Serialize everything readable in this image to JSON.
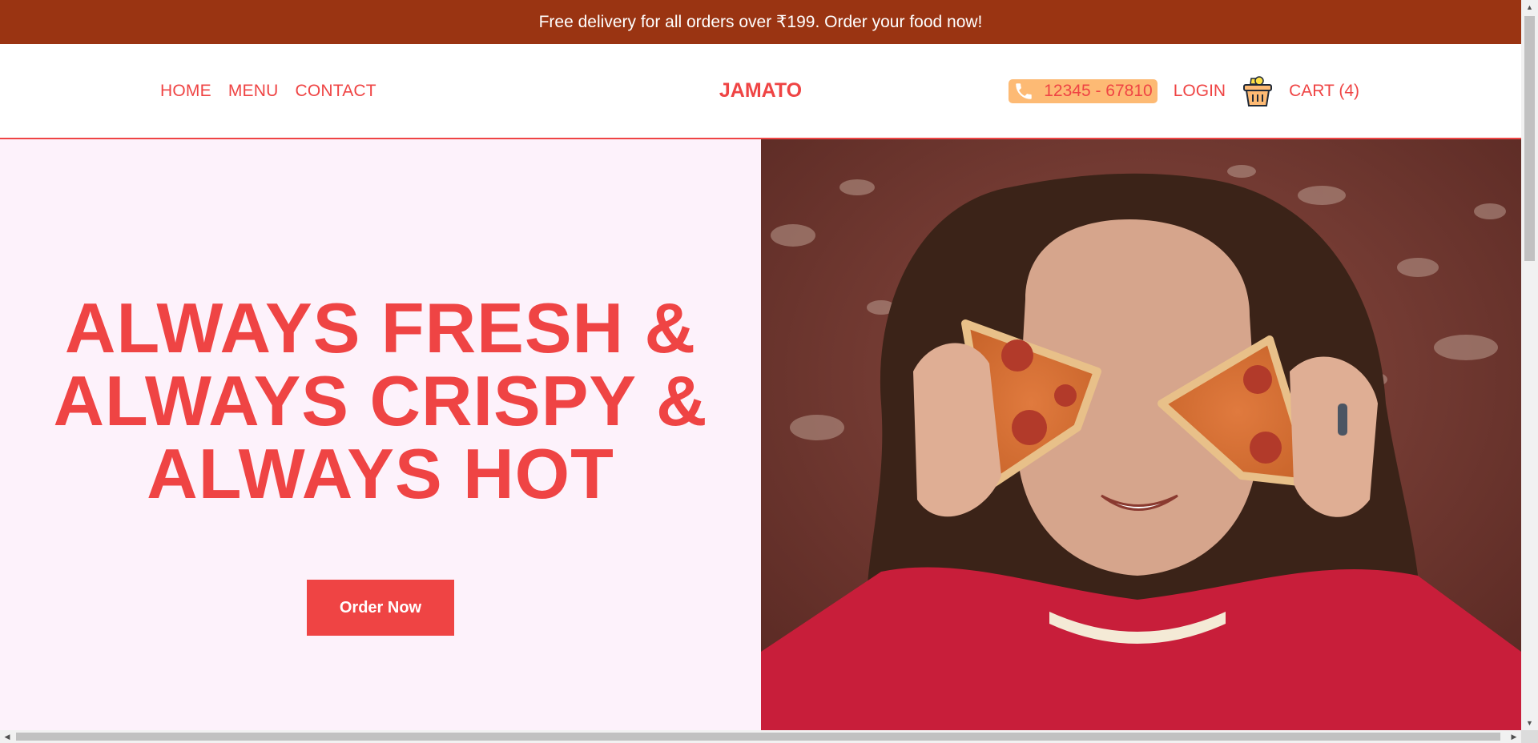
{
  "promo": {
    "text": "Free delivery for all orders over ₹199. Order your food now!"
  },
  "nav": {
    "links": [
      {
        "label": "HOME"
      },
      {
        "label": "MENU"
      },
      {
        "label": "CONTACT"
      }
    ],
    "brand": "JAMATO",
    "phone": "12345 - 67810",
    "login": "LOGIN",
    "cart": "CART (4)",
    "icons": {
      "phone": "phone-icon",
      "cart": "basket-icon"
    }
  },
  "hero": {
    "headline_lines": [
      "ALWAYS FRESH &",
      "ALWAYS CRISPY &",
      "ALWAYS HOT"
    ],
    "cta": "Order Now",
    "image": "photo-person-holding-pizza-slices-over-eyes"
  },
  "colors": {
    "promo_bg": "#9a3412",
    "accent": "#ef4444",
    "phone_pill": "#fdba74",
    "hero_bg": "#fdf2fb"
  }
}
